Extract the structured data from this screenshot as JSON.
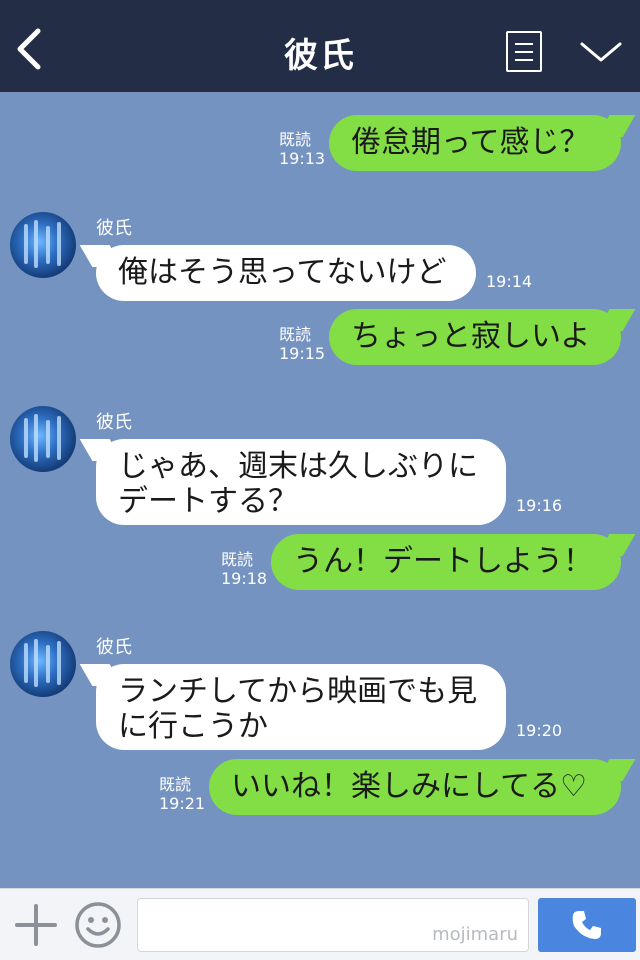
{
  "header": {
    "title": "彼氏"
  },
  "messages": [
    {
      "dir": "out",
      "text": "倦怠期って感じ？",
      "read": "既読",
      "time": "19:13"
    },
    {
      "dir": "in",
      "sender": "彼氏",
      "text": "俺はそう思ってないけど",
      "time": "19:14"
    },
    {
      "dir": "out",
      "text": "ちょっと寂しいよ",
      "read": "既読",
      "time": "19:15"
    },
    {
      "dir": "in",
      "sender": "彼氏",
      "line1": "じゃあ、週末は久しぶりに",
      "line2": "デートする？",
      "time": "19:16"
    },
    {
      "dir": "out",
      "text": "うん！デートしよう！",
      "read": "既読",
      "time": "19:18"
    },
    {
      "dir": "in",
      "sender": "彼氏",
      "line1": "ランチしてから映画でも見",
      "line2": "に行こうか",
      "time": "19:20"
    },
    {
      "dir": "out",
      "text": "いいね！楽しみにしてる♡",
      "read": "既読",
      "time": "19:21"
    }
  ],
  "input": {
    "watermark": "mojimaru"
  },
  "icons": {
    "back": "back-chevron-icon",
    "menu": "menu-list-icon",
    "collapse": "chevron-down-icon",
    "add": "plus-icon",
    "emoji": "smiley-icon",
    "call": "phone-icon"
  },
  "colors": {
    "header_bg": "#232d45",
    "chat_bg": "#7493c1",
    "outgoing_bubble": "#83dd45",
    "incoming_bubble": "#ffffff",
    "call_button": "#4a86e0"
  }
}
